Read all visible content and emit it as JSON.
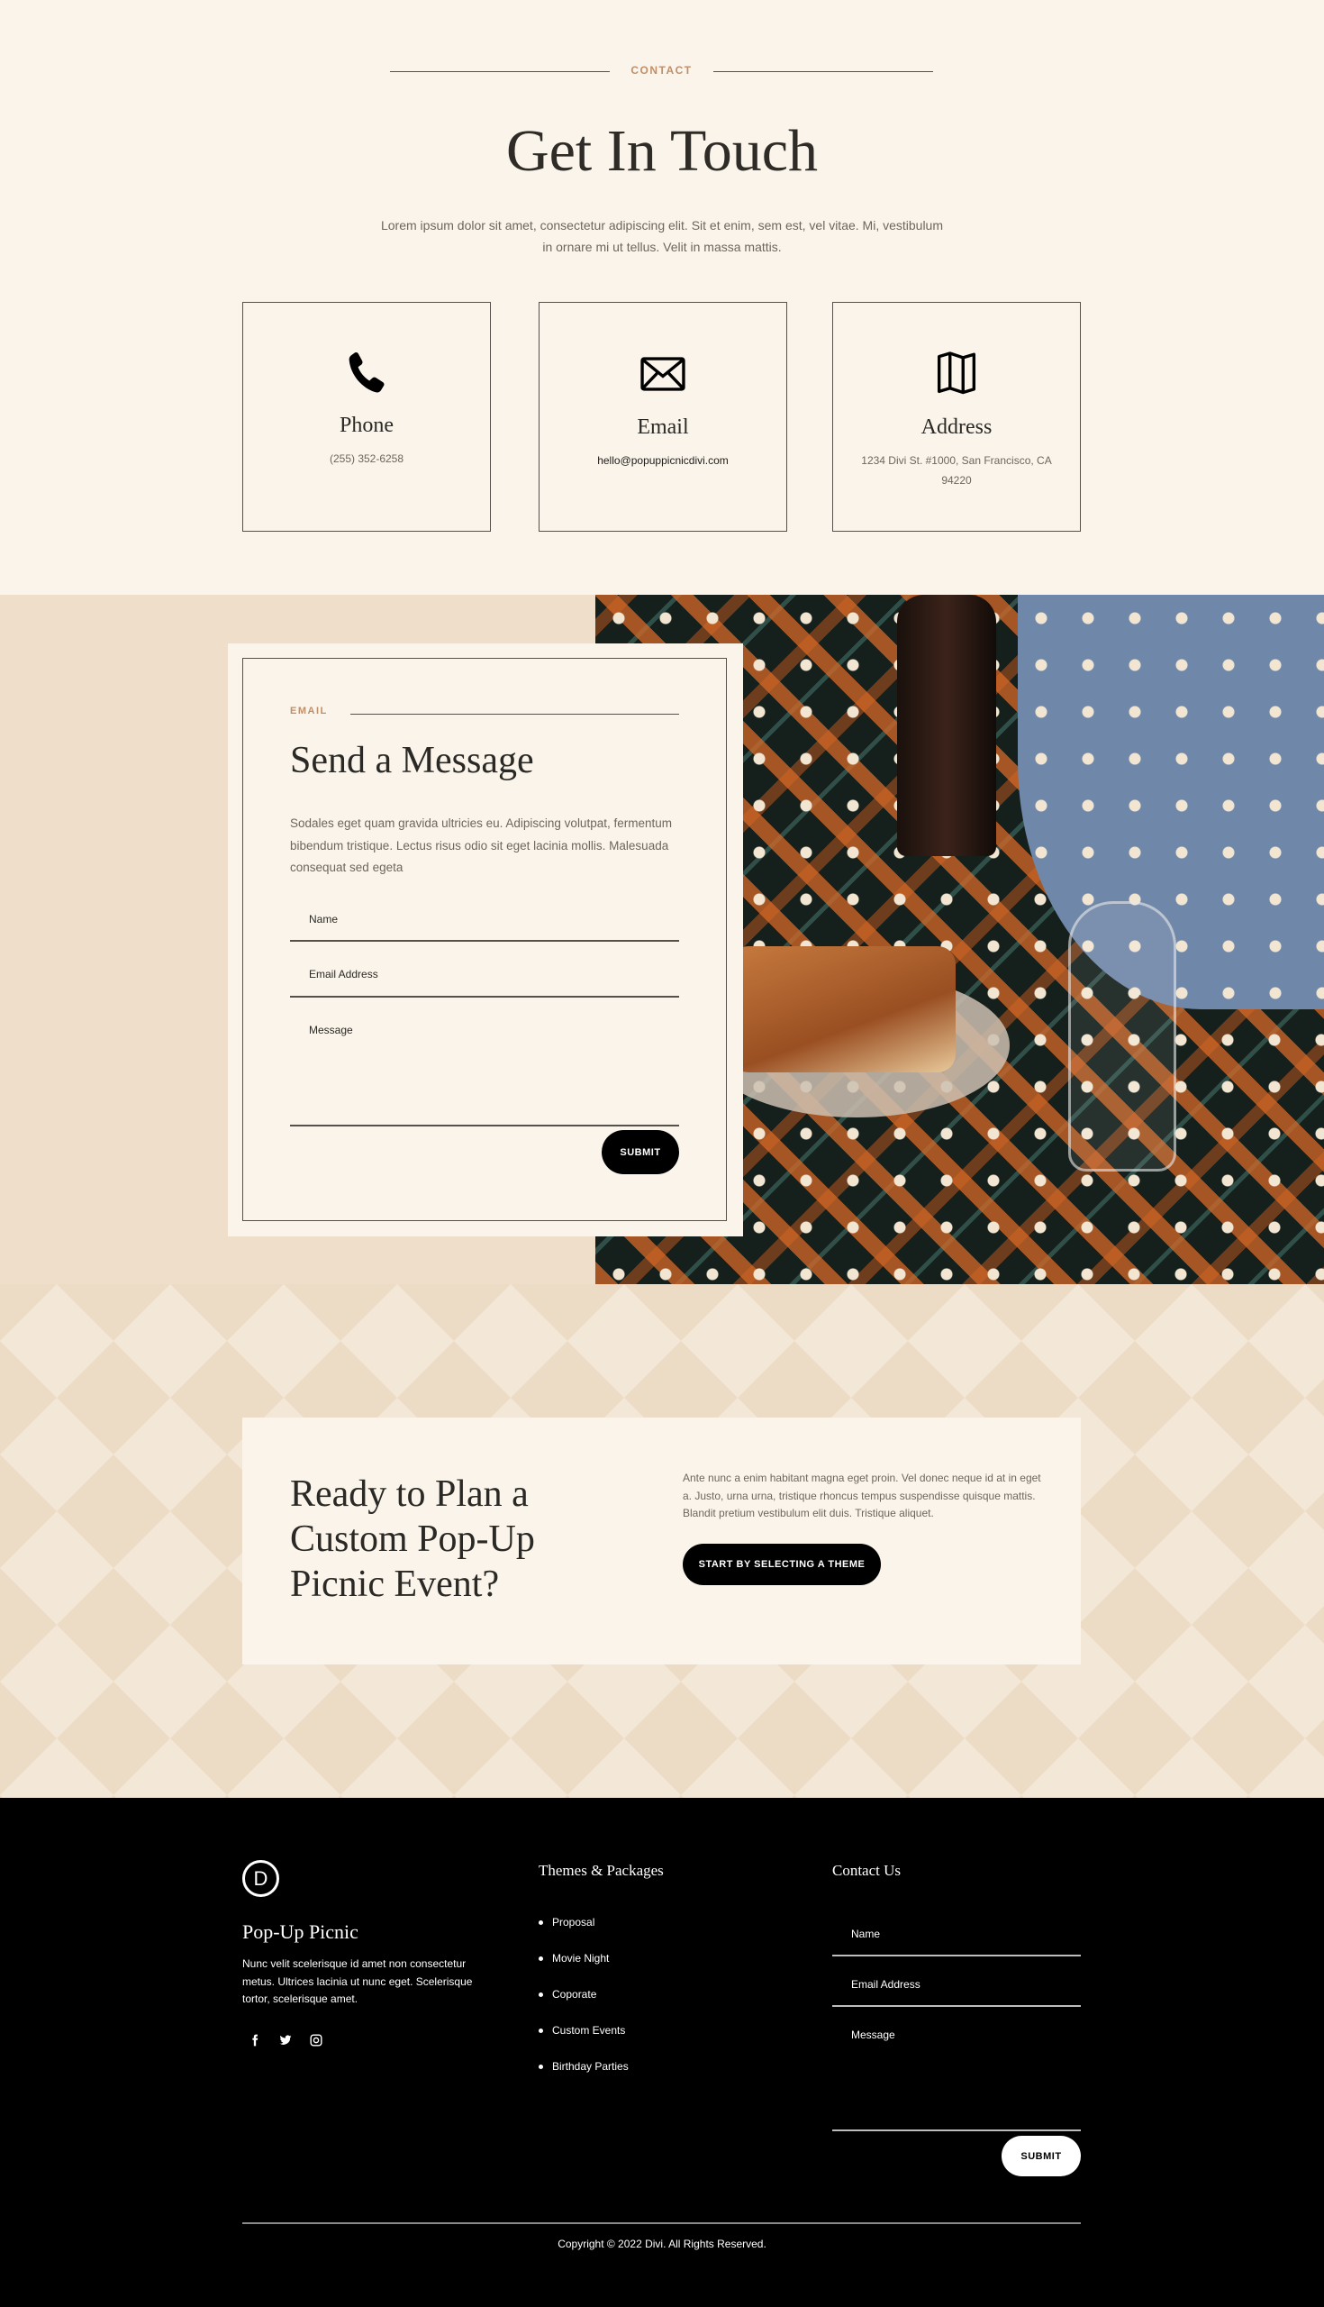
{
  "contact": {
    "eyebrow": "CONTACT",
    "title": "Get In Touch",
    "lede": "Lorem ipsum dolor sit amet, consectetur adipiscing elit. Sit et enim, sem est, vel vitae. Mi, vestibulum in ornare mi ut tellus. Velit in massa mattis.",
    "cards": [
      {
        "icon": "phone-icon",
        "title": "Phone",
        "value": "(255) 352-6258"
      },
      {
        "icon": "envelope-icon",
        "title": "Email",
        "value": "hello@popuppicnicdivi.com"
      },
      {
        "icon": "map-icon",
        "title": "Address",
        "value": "1234 Divi St. #1000, San Francisco, CA 94220"
      }
    ]
  },
  "message": {
    "eyebrow": "EMAIL",
    "title": "Send a Message",
    "text": "Sodales eget quam gravida ultricies eu. Adipiscing volutpat, fermentum bibendum tristique. Lectus risus odio sit eget lacinia mollis. Malesuada consequat sed egeta",
    "name_placeholder": "Name",
    "email_placeholder": "Email Address",
    "message_placeholder": "Message",
    "submit": "SUBMIT"
  },
  "cta": {
    "title_lines": [
      "Ready to Plan a",
      "Custom Pop-Up",
      "Picnic Event?"
    ],
    "text": "Ante nunc a enim habitant magna eget proin. Vel donec neque id at in eget a. Justo, urna urna, tristique rhoncus tempus suspendisse quisque mattis. Blandit pretium vestibulum elit duis. Tristique aliquet.",
    "button": "START BY SELECTING A THEME"
  },
  "footer": {
    "logo_letter": "D",
    "brand": "Pop-Up Picnic",
    "about": "Nunc velit scelerisque id amet non consectetur metus. Ultrices lacinia ut nunc eget. Scelerisque tortor, scelerisque amet.",
    "social": [
      "facebook-icon",
      "twitter-icon",
      "instagram-icon"
    ],
    "themes_title": "Themes & Packages",
    "themes": [
      "Proposal",
      "Movie Night",
      "Coporate",
      "Custom Events",
      "Birthday Parties"
    ],
    "contact_title": "Contact Us",
    "name_placeholder": "Name",
    "email_placeholder": "Email Address",
    "message_placeholder": "Message",
    "submit": "SUBMIT",
    "copyright": "Copyright © 2022 Divi. All Rights Reserved."
  },
  "colors": {
    "accent": "#c08f6a",
    "cream": "#faf4ea",
    "sand": "#efdfca",
    "dark": "#000000"
  }
}
